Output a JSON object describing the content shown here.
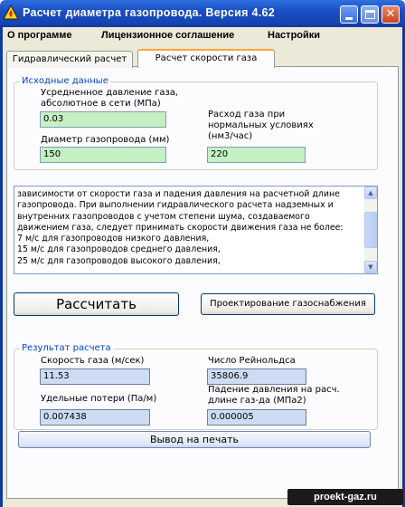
{
  "window": {
    "title": "Расчет диаметра газопровода. Версия 4.62"
  },
  "menu": [
    "О программе",
    "Лицензионное соглашение",
    "Настройки"
  ],
  "tabs": [
    {
      "label": "Гидравлический расчет",
      "active": false
    },
    {
      "label": "Расчет скорости газа",
      "active": true
    }
  ],
  "inputs": {
    "legend": "Исходные данные",
    "pressure_label_1": "Усредненное давление газа,",
    "pressure_label_2": "абсолютное в сети (МПа)",
    "pressure_value": "0.03",
    "diameter_label": "Диаметр газопровода (мм)",
    "diameter_value": "150",
    "flow_label_1": "Расход газа при",
    "flow_label_2": "нормальных условиях",
    "flow_label_3": "(нм3/час)",
    "flow_value": "220"
  },
  "memo": {
    "lines": [
      "зависимости от скорости газа и падения давления на расчетной длине",
      "газопровода.  При выполнении гидравлического расчета надземных и",
      "внутренних газопроводов с учетом степени шума, создаваемого",
      "движением газа, следует принимать скорости движения газа не более:",
      "7 м/с для газопроводов низкого давления,",
      "15 м/с для газопроводов среднего давления,",
      "25 м/с для газопроводов высокого давления,"
    ]
  },
  "buttons": {
    "calculate": "Рассчитать",
    "design": "Проектирование газоснабжения",
    "print": "Вывод на печать"
  },
  "results": {
    "legend": "Результат расчета",
    "speed_label": "Скорость газа (м/сек)",
    "speed_value": "11.53",
    "reynolds_label": "Число Рейнольдса",
    "reynolds_value": "35806.9",
    "losses_label": "Удельные потери (Па/м)",
    "losses_value": "0.007438",
    "drop_label_1": "Падение давления на расч.",
    "drop_label_2": "длине газ-да (МПа2)",
    "drop_value": "0.000005"
  },
  "watermark": "proekt-gaz.ru",
  "colors": {
    "input_green": "#c4f0c4",
    "output_blue": "#cddcf2",
    "legend_blue": "#0046d5",
    "titlebar": "#1a4fc4"
  }
}
